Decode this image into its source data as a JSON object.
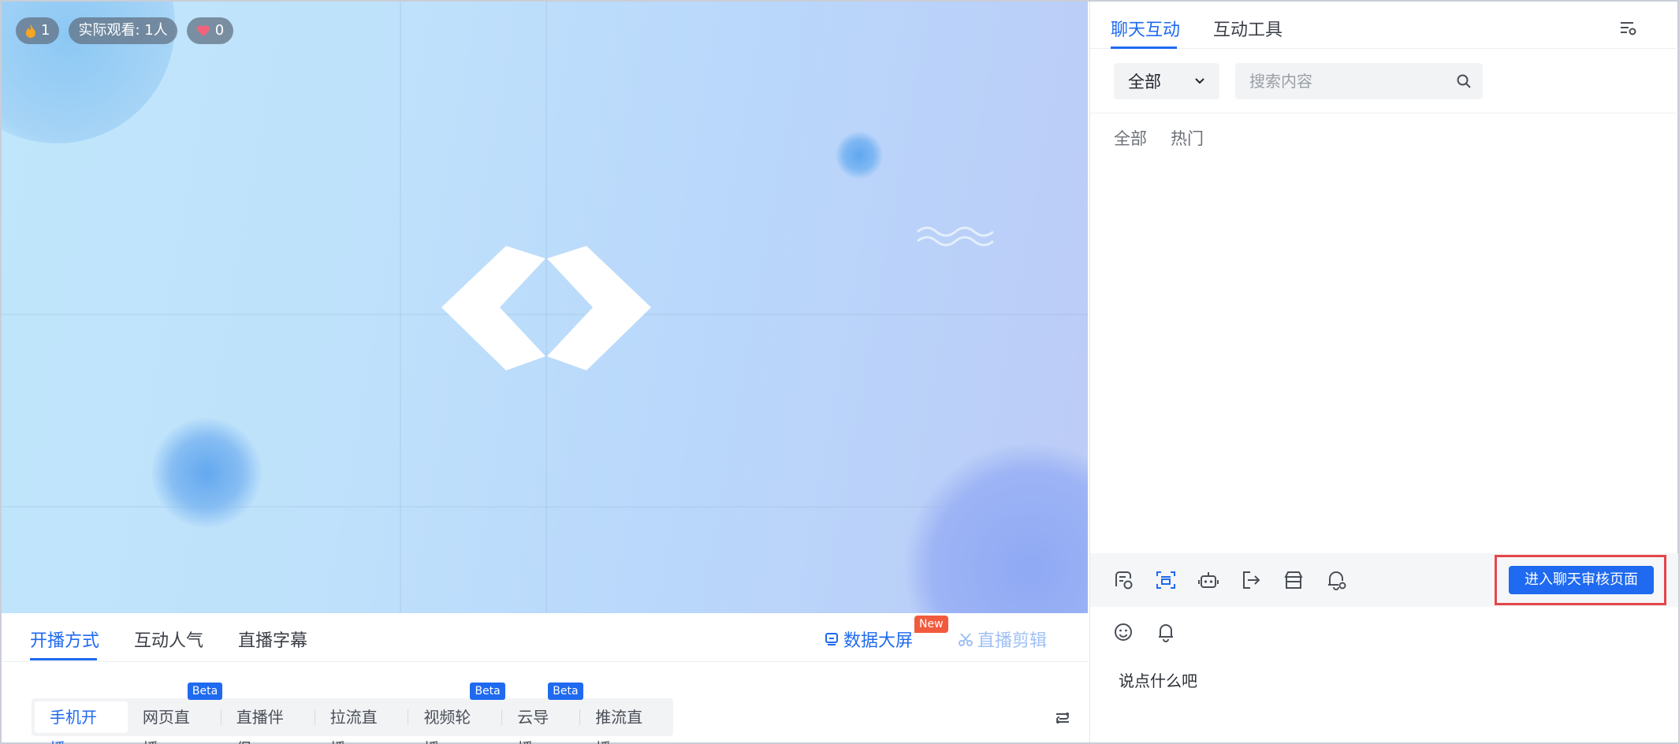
{
  "video": {
    "badges": [
      {
        "icon": "flame-icon",
        "text": "1"
      },
      {
        "icon": "",
        "text": "实际观看: 1人"
      },
      {
        "icon": "heart-icon",
        "text": "0"
      }
    ]
  },
  "left_tabs": {
    "items": [
      "开播方式",
      "互动人气",
      "直播字幕"
    ],
    "active": 0,
    "data_screen": "数据大屏",
    "new_badge": "New",
    "clip": "直播剪辑"
  },
  "modes": {
    "items": [
      {
        "label": "手机开播",
        "badge": ""
      },
      {
        "label": "网页直播",
        "badge": "Beta"
      },
      {
        "label": "直播伴侣",
        "badge": ""
      },
      {
        "label": "拉流直播",
        "badge": ""
      },
      {
        "label": "视频轮播",
        "badge": "Beta"
      },
      {
        "label": "云导播",
        "badge": "Beta"
      },
      {
        "label": "推流直播",
        "badge": ""
      }
    ],
    "active": 0
  },
  "right_panel": {
    "tabs": [
      "聊天互动",
      "互动工具"
    ],
    "active_tab": 0,
    "filter_select": "全部",
    "search_placeholder": "搜索内容",
    "sub_filters": [
      "全部",
      "热门"
    ],
    "review_button": "进入聊天审核页面",
    "chat_placeholder": "说点什么吧"
  },
  "colors": {
    "accent": "#1f6af0",
    "new_badge": "#f25a3d",
    "highlight_border": "#e5454a"
  }
}
